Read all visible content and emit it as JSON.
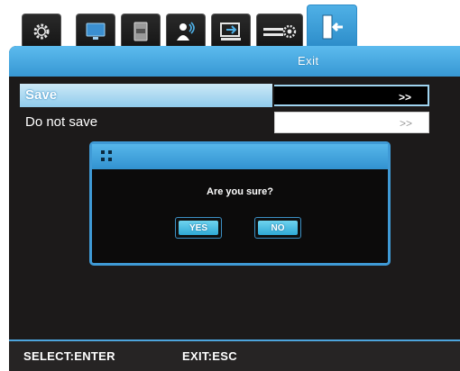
{
  "tabs": [
    {
      "icon": "gear-icon",
      "active": false
    },
    {
      "icon": "monitor-icon",
      "active": false
    },
    {
      "icon": "hdd-icon",
      "active": false
    },
    {
      "icon": "network-user-icon",
      "active": false
    },
    {
      "icon": "system-icon",
      "active": false
    },
    {
      "icon": "slider-settings-icon",
      "active": false
    },
    {
      "icon": "exit-door-icon",
      "active": true
    }
  ],
  "header": {
    "title": "Exit"
  },
  "menu": {
    "items": [
      {
        "label": "Save",
        "value": ">>",
        "selected": true
      },
      {
        "label": "Do not save",
        "value": ">>",
        "selected": false
      }
    ]
  },
  "dialog": {
    "message": "Are you sure?",
    "yes_label": "YES",
    "no_label": "NO"
  },
  "footer": {
    "select_hint": "SELECT:ENTER",
    "exit_hint": "EXIT:ESC"
  },
  "colors": {
    "accent": "#3f9ad6",
    "panel_bg": "#1c1a1a",
    "selected_row": "#a8d8f2"
  }
}
